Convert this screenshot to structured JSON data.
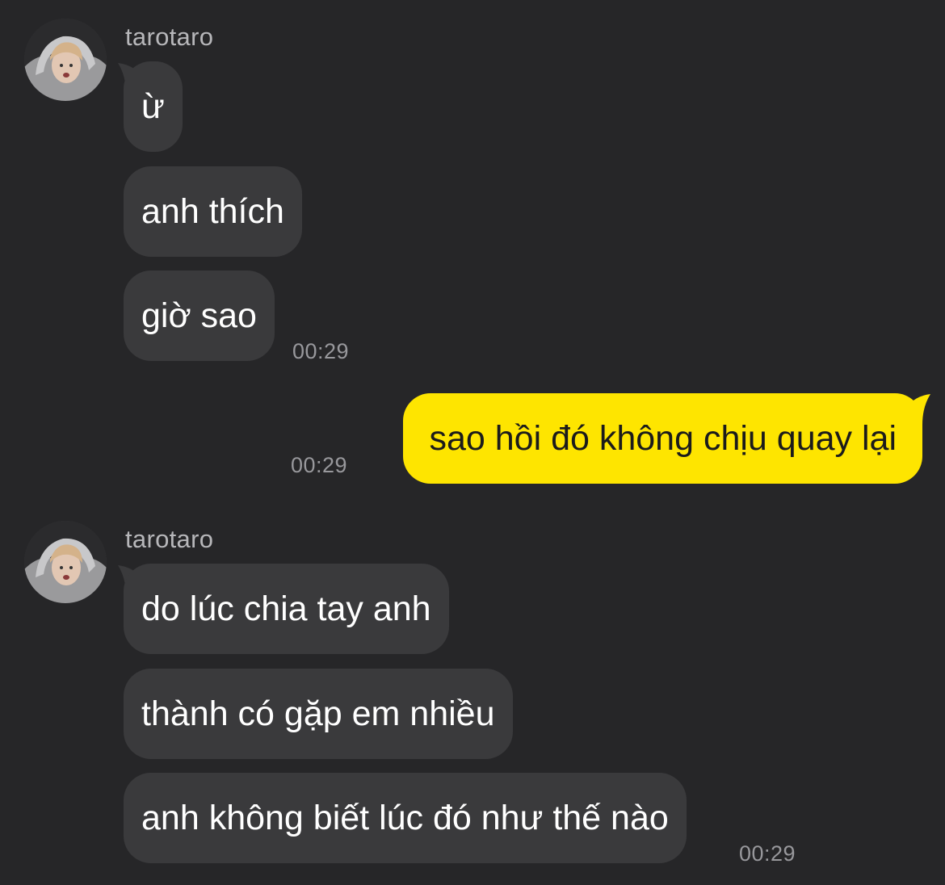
{
  "colors": {
    "background": "#262628",
    "incoming_bubble": "#3a3a3c",
    "outgoing_bubble": "#fee500",
    "timestamp": "#98989c",
    "sender_name": "#b7b7ba"
  },
  "conversation": {
    "groups": [
      {
        "type": "incoming",
        "sender": "tarotaro",
        "avatar_icon": "profile-photo",
        "messages": [
          "ừ",
          "anh thích",
          "giờ sao"
        ],
        "time": "00:29"
      },
      {
        "type": "outgoing",
        "messages": [
          "sao hồi đó không chịu quay lại"
        ],
        "time": "00:29"
      },
      {
        "type": "incoming",
        "sender": "tarotaro",
        "avatar_icon": "profile-photo",
        "messages": [
          "do lúc chia tay anh",
          "thành có gặp em nhiều",
          "anh không biết lúc đó như thế nào"
        ],
        "time": "00:29"
      }
    ]
  }
}
